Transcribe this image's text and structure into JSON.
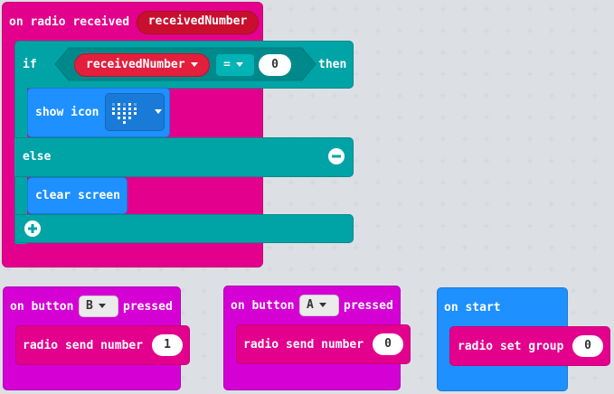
{
  "radio_event": {
    "label": "on radio received",
    "param": "receivedNumber",
    "if_label": "if",
    "cond_var": "receivedNumber",
    "operator": "=",
    "compare_value": "0",
    "then_label": "then",
    "show_icon_label": "show icon",
    "icon_name": "heart-icon",
    "else_label": "else",
    "clear_label": "clear screen"
  },
  "button_b": {
    "on_label": "on button",
    "button": "B",
    "pressed_label": "pressed",
    "action_label": "radio send number",
    "value": "1"
  },
  "button_a": {
    "on_label": "on button",
    "button": "A",
    "pressed_label": "pressed",
    "action_label": "radio send number",
    "value": "0"
  },
  "on_start": {
    "label": "on start",
    "action_label": "radio set group",
    "value": "0"
  },
  "colors": {
    "radio": "#e3008c",
    "logic": "#00a4a6",
    "basic": "#1e90ff",
    "input": "#d400d4",
    "variable": "#dc143c",
    "background": "#f0f1f3"
  }
}
